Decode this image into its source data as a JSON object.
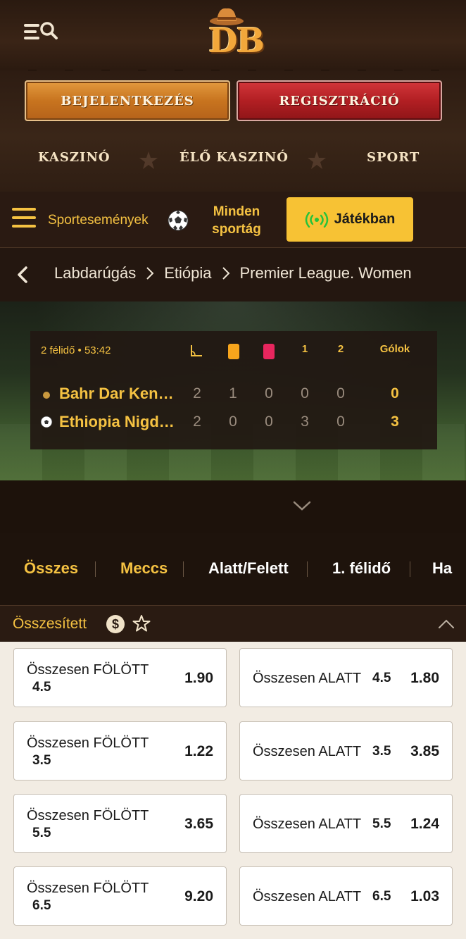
{
  "header": {
    "logo_text": "DB"
  },
  "auth": {
    "login_label": "BEJELENTKEZÉS",
    "register_label": "REGISZTRÁCIÓ"
  },
  "nav": {
    "casino": "KASZINÓ",
    "live_casino": "ÉLŐ KASZINÓ",
    "sport": "SPORT"
  },
  "sportbar": {
    "events_label": "Sportesemények",
    "all_sports_line1": "Minden",
    "all_sports_line2": "sportág",
    "live_label": "Játékban"
  },
  "breadcrumb": {
    "items": [
      "Labdarúgás",
      "Etiópia",
      "Premier League. Women"
    ]
  },
  "scoreboard": {
    "time": "2 félidő • 53:42",
    "headers": {
      "yellow": "",
      "red": "",
      "h1": "1",
      "h2": "2",
      "goals": "Gólok"
    },
    "teams": [
      {
        "name": "Bahr Dar Kenema",
        "corners": "2",
        "yellow": "1",
        "red": "0",
        "h1": "0",
        "h2": "0",
        "goals": "0"
      },
      {
        "name": "Ethiopia Nigd Bank",
        "corners": "2",
        "yellow": "0",
        "red": "0",
        "h1": "3",
        "h2": "0",
        "goals": "3"
      }
    ]
  },
  "tabs": [
    "Összes",
    "Meccs",
    "Alatt/Felett",
    "1. félidő",
    "Ha"
  ],
  "section": {
    "title": "Összesített"
  },
  "odds": [
    {
      "over_label": "Összesen FÖLÖTT",
      "over_line": "4.5",
      "over_price": "1.90",
      "under_label": "Összesen ALATT",
      "under_line": "4.5",
      "under_price": "1.80"
    },
    {
      "over_label": "Összesen FÖLÖTT",
      "over_line": "3.5",
      "over_price": "1.22",
      "under_label": "Összesen ALATT",
      "under_line": "3.5",
      "under_price": "3.85"
    },
    {
      "over_label": "Összesen FÖLÖTT",
      "over_line": "5.5",
      "over_price": "3.65",
      "under_label": "Összesen ALATT",
      "under_line": "5.5",
      "under_price": "1.24"
    },
    {
      "over_label": "Összesen FÖLÖTT",
      "over_line": "6.5",
      "over_price": "9.20",
      "under_label": "Összesen ALATT",
      "under_line": "6.5",
      "under_price": "1.03"
    }
  ],
  "colors": {
    "accent": "#f5c242",
    "login": "#c8741f",
    "register": "#b21f23",
    "live_button": "#f7c234",
    "live_signal": "#27c23a"
  }
}
